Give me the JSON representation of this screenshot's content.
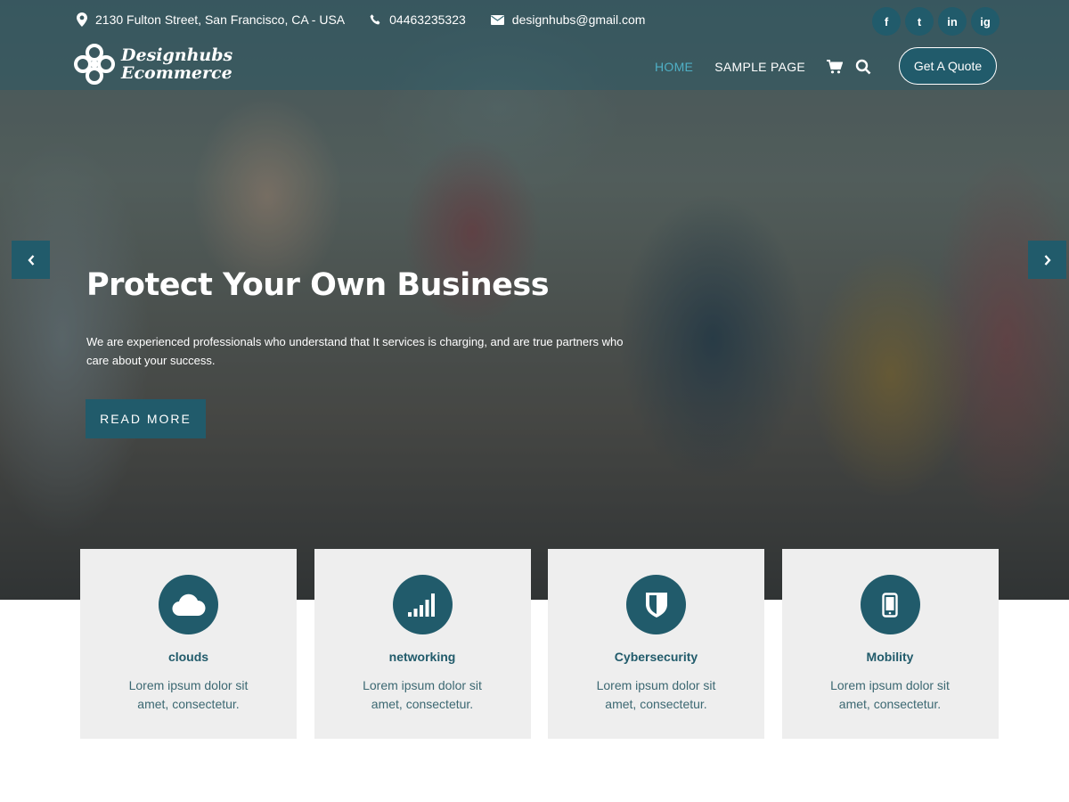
{
  "topbar": {
    "address": "2130 Fulton Street, San Francisco, CA - USA",
    "phone": "04463235323",
    "email": "designhubs@gmail.com",
    "social": [
      {
        "label": "f",
        "icon": "facebook-icon"
      },
      {
        "label": "t",
        "icon": "twitter-icon"
      },
      {
        "label": "in",
        "icon": "linkedin-icon"
      },
      {
        "label": "ig",
        "icon": "instagram-icon"
      }
    ]
  },
  "logo": {
    "line1": "Designhubs",
    "line2": "Ecommerce"
  },
  "nav": {
    "items": [
      {
        "label": "HOME",
        "active": true
      },
      {
        "label": "SAMPLE PAGE",
        "active": false
      }
    ],
    "cart_icon": "cart-icon",
    "search_icon": "search-icon",
    "quote_label": "Get A Quote"
  },
  "hero": {
    "title": "Protect Your Own Business",
    "description": "We are experienced professionals who understand that It services is charging, and are true partners who care about your success.",
    "button_label": "READ MORE",
    "prev_icon": "chevron-left-icon",
    "next_icon": "chevron-right-icon"
  },
  "services": [
    {
      "title": "clouds",
      "text": "Lorem ipsum dolor sit amet, consectetur.",
      "icon": "cloud-icon"
    },
    {
      "title": "networking",
      "text": "Lorem ipsum dolor sit amet, consectetur.",
      "icon": "signal-bars-icon"
    },
    {
      "title": "Cybersecurity",
      "text": "Lorem ipsum dolor sit amet, consectetur.",
      "icon": "shield-icon"
    },
    {
      "title": "Mobility",
      "text": "Lorem ipsum dolor sit amet, consectetur.",
      "icon": "mobile-phone-icon"
    }
  ],
  "colors": {
    "accent": "#215b6b",
    "active_nav": "#4fb0c6",
    "card_bg": "#eeeeee"
  }
}
